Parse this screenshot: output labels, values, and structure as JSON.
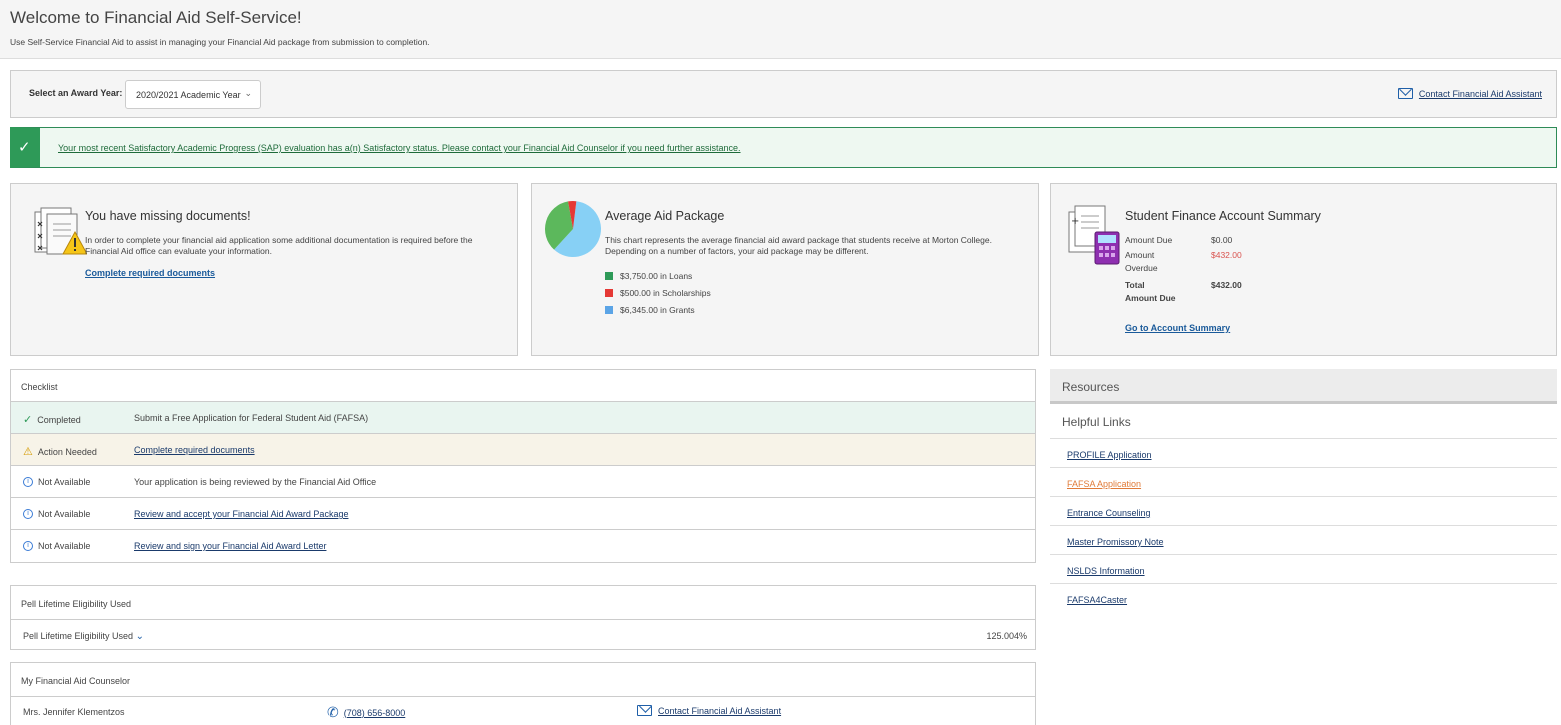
{
  "header": {
    "title": "Welcome to Financial Aid Self-Service!",
    "subtitle": "Use Self-Service Financial Aid to assist in managing your Financial Aid package from submission to completion."
  },
  "award_year": {
    "label": "Select an Award Year:",
    "selected": "2020/2021 Academic Year",
    "contact_link": "Contact Financial Aid Assistant"
  },
  "sap": {
    "message": "Your most recent Satisfactory Academic Progress (SAP) evaluation has a(n) Satisfactory status. Please contact your Financial Aid Counselor if you need further assistance."
  },
  "missing_docs": {
    "title": "You have missing documents!",
    "text": "In order to complete your financial aid application some additional documentation is required before the Financial Aid office can evaluate your information.",
    "link": "Complete required documents"
  },
  "aid_package": {
    "title": "Average Aid Package",
    "text": "This chart represents the average financial aid award package that students receive at Morton College. Depending on a number of factors, your aid package may be different.",
    "legend": [
      {
        "label": "$3,750.00 in Loans",
        "color": "#2e9a58",
        "value": 3750
      },
      {
        "label": "$500.00 in Scholarships",
        "color": "#e53935",
        "value": 500
      },
      {
        "label": "$6,345.00 in Grants",
        "color": "#5ba4e6",
        "value": 6345
      }
    ],
    "pie_colors": {
      "grants": "#87d0f5",
      "loans": "#5cb85c",
      "scholarships": "#e53935"
    }
  },
  "account_summary": {
    "title": "Student Finance Account Summary",
    "amount_due_label": "Amount Due",
    "amount_due_value": "$0.00",
    "amount_overdue_label_1": "Amount",
    "amount_overdue_label_2": "Overdue",
    "amount_overdue_value": "$432.00",
    "total_label_1": "Total",
    "total_label_2": "Amount Due",
    "total_value": "$432.00",
    "link": "Go to Account Summary"
  },
  "checklist": {
    "header": "Checklist",
    "rows": [
      {
        "status": "Completed",
        "desc": "Submit a Free Application for Federal Student Aid (FAFSA)"
      },
      {
        "status": "Action Needed",
        "desc": "Complete required documents"
      },
      {
        "status": "Not Available",
        "desc": "Your application is being reviewed by the Financial Aid Office"
      },
      {
        "status": "Not Available",
        "desc": "Review and accept your Financial Aid Award Package"
      },
      {
        "status": "Not Available",
        "desc": "Review and sign your Financial Aid Award Letter"
      }
    ]
  },
  "pell": {
    "header": "Pell Lifetime Eligibility Used",
    "row_label": "Pell Lifetime Eligibility Used",
    "value": "125.004%"
  },
  "counselor": {
    "header": "My Financial Aid Counselor",
    "name": "Mrs. Jennifer Klementzos",
    "phone": "(708) 656-8000",
    "contact": "Contact Financial Aid Assistant"
  },
  "resources": {
    "title": "Resources",
    "helpful_title": "Helpful Links",
    "links": [
      "PROFILE Application",
      "FAFSA Application",
      "Entrance Counseling",
      "Master Promissory Note",
      "NSLDS Information",
      "FAFSA4Caster"
    ]
  }
}
